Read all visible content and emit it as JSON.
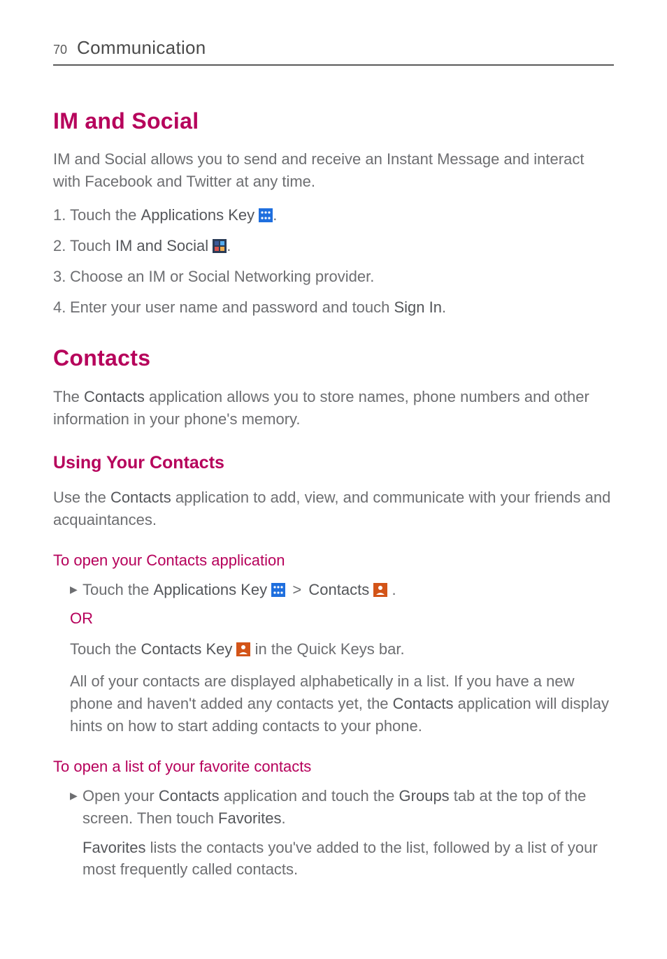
{
  "header": {
    "page_number": "70",
    "chapter": "Communication"
  },
  "sec_im": {
    "title": "IM and Social",
    "intro": "IM and Social allows you to send and receive an Instant Message and interact with Facebook and Twitter at any time.",
    "steps": {
      "s1_pre": "Touch the ",
      "s1_bold": "Applications Key",
      "s2_pre": "Touch ",
      "s2_bold": "IM and Social",
      "s3": "Choose an IM or Social Networking provider.",
      "s4_pre": "Enter your user name and password and touch ",
      "s4_bold": "Sign In",
      "s4_post": "."
    }
  },
  "sec_contacts": {
    "title": "Contacts",
    "intro_pre": "The ",
    "intro_bold": "Contacts",
    "intro_post": " application allows you to store names, phone numbers and other information in your phone's memory.",
    "using_title": "Using Your Contacts",
    "using_pre": "Use the ",
    "using_bold": "Contacts",
    "using_post": " application to add, view, and communicate with your friends and acquaintances.",
    "open_title": "To open your Contacts application",
    "open1_pre": "Touch the ",
    "open1_bold1": "Applications Key",
    "open1_gt": " > ",
    "open1_bold2": "Contacts",
    "open1_post": " .",
    "or": "OR",
    "open2_pre": "Touch the ",
    "open2_bold": "Contacts Key",
    "open2_post": " in the Quick Keys bar.",
    "alpha_pre": "All of your contacts are displayed alphabetically in a list. If you have a new phone and haven't added any contacts yet, the ",
    "alpha_bold": "Contacts",
    "alpha_post": " application will display hints on how to start adding contacts to your phone.",
    "fav_title": "To open a list of your favorite contacts",
    "fav1_pre": "Open your ",
    "fav1_bold1": "Contacts",
    "fav1_mid": " application and touch the ",
    "fav1_bold2": "Groups",
    "fav1_mid2": " tab at the top of the screen. Then touch ",
    "fav1_bold3": "Favorites",
    "fav1_post": ".",
    "fav2_bold": "Favorites",
    "fav2_post": " lists the contacts you've added to the list, followed by a list of your most frequently called contacts."
  },
  "nums": {
    "n1": "1.",
    "n2": "2.",
    "n3": "3.",
    "n4": "4."
  }
}
